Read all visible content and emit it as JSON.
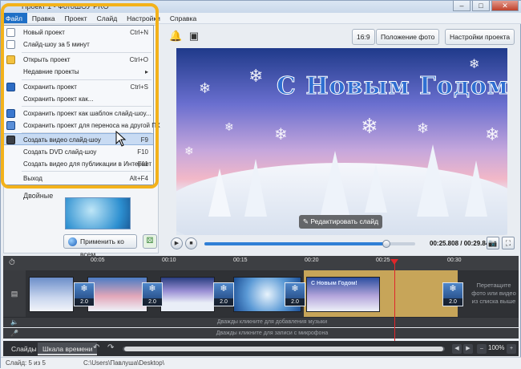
{
  "window": {
    "title": "Проект 1 - ФотоШОУ PRO",
    "controls": [
      "–",
      "□",
      "✕"
    ]
  },
  "menubar": [
    "Файл",
    "Правка",
    "Проект",
    "Слайд",
    "Настройки",
    "Справка"
  ],
  "file_menu": {
    "items": [
      {
        "label": "Новый проект",
        "shortcut": "Ctrl+N",
        "icon": "new-file-icon"
      },
      {
        "label": "Слайд-шоу за 5 минут",
        "shortcut": "",
        "icon": "wizard-icon"
      },
      {
        "label": "Открыть проект",
        "shortcut": "Ctrl+O",
        "icon": "open-folder-icon"
      },
      {
        "label": "Недавние проекты",
        "shortcut": "▸",
        "icon": ""
      },
      {
        "label": "Сохранить проект",
        "shortcut": "Ctrl+S",
        "icon": "save-icon"
      },
      {
        "label": "Сохранить проект как...",
        "shortcut": "",
        "icon": ""
      },
      {
        "label": "Сохранить проект как шаблон слайд-шоу...",
        "shortcut": "",
        "icon": "save-template-icon"
      },
      {
        "label": "Сохранить проект для переноса на другой ПК",
        "shortcut": "",
        "icon": "transfer-icon"
      },
      {
        "label": "Создать видео слайд-шоу",
        "shortcut": "F9",
        "icon": "video-icon"
      },
      {
        "label": "Создать DVD слайд-шоу",
        "shortcut": "F10",
        "icon": ""
      },
      {
        "label": "Создать видео для публикации в Интернет",
        "shortcut": "F11",
        "icon": ""
      },
      {
        "label": "Выход",
        "shortcut": "Alt+F4",
        "icon": ""
      }
    ]
  },
  "toolbar": {
    "aspect": "16:9",
    "photo_position": "Положение фото",
    "project_settings": "Настройки проекта"
  },
  "left_panel": {
    "category_label": "Двойные",
    "apply_all": "Применить ко всем"
  },
  "preview": {
    "greeting": "С Новым Годом!",
    "edit_slide": "Редактировать слайд"
  },
  "player": {
    "time_current": "00:25.808",
    "time_total": "00:29.844",
    "time_separator": " / ",
    "progress_fraction": 0.865
  },
  "timeline": {
    "ticks": [
      "00:05",
      "00:10",
      "00:15",
      "00:20",
      "00:25",
      "00:30"
    ],
    "transition_duration": "2.0",
    "drop_hint": "Перетащите фото или видео из списка выше",
    "music_lane": "Дважды кликните для добавления музыки",
    "mic_lane": "Дважды кликните для записи с микрофона",
    "slide_text": "С Новым Годом!"
  },
  "bottom_bar": {
    "tab_slides": "Слайды",
    "tab_timeline": "Шкала времени",
    "zoom": "100%",
    "zoom_out": "–",
    "zoom_in": "+"
  },
  "status": {
    "slide": "Слайд: 5 из 5",
    "path": "C:\\Users\\Павлуша\\Desktop\\"
  },
  "colors": {
    "menu_accent": "#1f6fc6",
    "highlight_frame": "#f3b21b",
    "playhead": "#e0262a",
    "selected_clip": "#d8b25d"
  }
}
